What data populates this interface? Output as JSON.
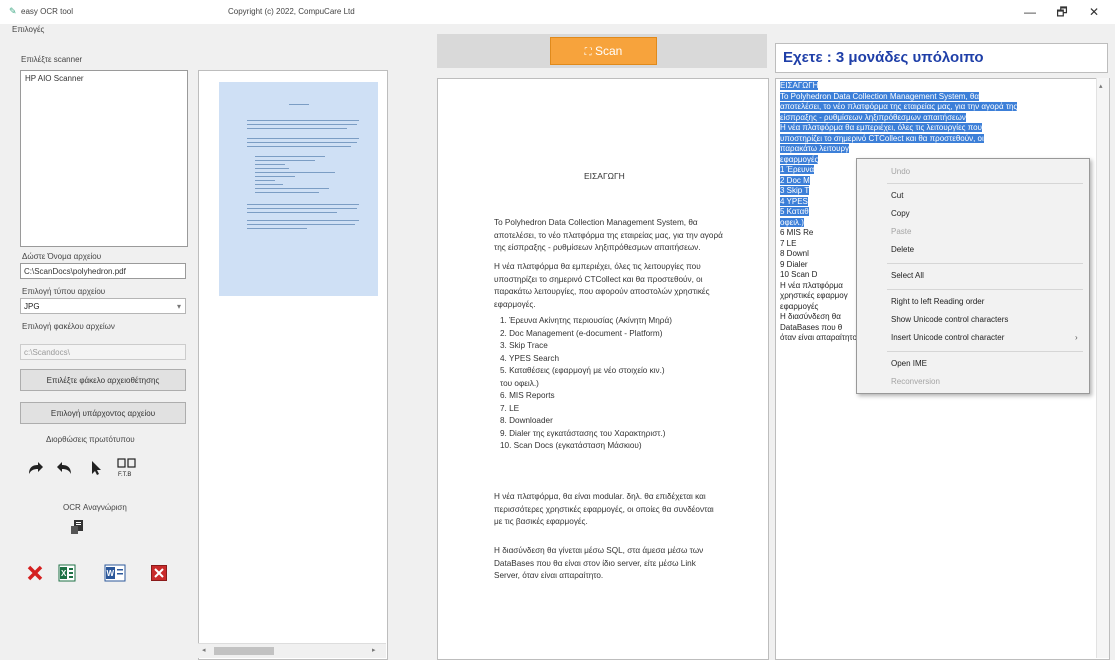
{
  "window": {
    "title": "easy OCR tool",
    "copyright": "Copyright (c) 2022, CompuCare Ltd",
    "minimize": "—",
    "maximize": "🗗",
    "close": "✕"
  },
  "menu": {
    "options": "Επιλογές"
  },
  "left": {
    "scanner_label": "Επιλέξτε scanner",
    "scanners": [
      "HP AIO Scanner"
    ],
    "filename_label": "Δώστε Όνομα αρχείου",
    "filename_value": "C:\\ScanDocs\\polyhedron.pdf",
    "filetype_label": "Επιλογή τύπου αρχείου",
    "filetype_value": "JPG",
    "folder_label": "Επιλογή φακέλου αρχείων",
    "folder_value": "c:\\Scandocs\\",
    "select_folder_button": "Επιλέξτε φάκελο αρχειοθέτησης",
    "select_existing_button": "Επιλογή υπάρχοντος αρχείου",
    "original_edit_label": "Διορθώσεις πρωτότυπου",
    "ocr_label": "OCR Αναγνώριση",
    "page_icon_text": "F.T.B"
  },
  "scan": {
    "button_label": "Scan"
  },
  "document": {
    "heading": "ΕΙΣΑΓΩΓΗ",
    "p1": "Το Polyhedron Data Collection Management System, θα αποτελέσει, το νέο πλατφόρμα της εταιρείας μας, για την αγορά της είσπραξης - ρυθμίσεων  ληξιπρόθεσμων απαιτήσεων.",
    "p2": "Η νέα πλατφόρμα θα εμπεριέχει, όλες τις λειτουργίες που υποστηρίζει το σημερινό CTCollect και θα προστεθούν, οι παρακάτω λειτουργίες, που αφορούν αποστολών χρηστικές εφαρμογές.",
    "list": [
      "1. Έρευνα Ακίνητης περιουσίας (Ακίνητη Μηρά)",
      "2. Doc Management (e-document - Platform)",
      "3. Skip Trace",
      "4. YPES Search",
      "5. Καταθέσεις (εφαρμογή με νέο στοιχείο κιν.)",
      "   του οφειλ.)",
      "6. MIS Reports",
      "7. LE",
      "8. Downloader",
      "9. Dialer της εγκατάστασης του Χαρακτηριστ.)",
      "10.    Scan Docs (εγκατάσταση Μάσκιου)"
    ],
    "p3": "Η νέα πλατφόρμα, θα είναι modular. δηλ. θα επιδέχεται και περισσότερες χρηστικές εφαρμογές, οι οποίες θα συνδέονται με τις βασικές εφαρμογές.",
    "p4": "Η διασύνδεση θα γίνεται μέσω SQL, στα άμεσα μέσω των DataBases που θα είναι στον ίδιο server, είτε μέσω Link Server, όταν είναι απαραίτητο."
  },
  "right": {
    "balance": "Εχετε : 3 μονάδες υπόλοιπο",
    "ocr_lines": [
      {
        "t": "ΕΙΣΑΓΩΓΗ",
        "h": true
      },
      {
        "t": "Το Polyhedron Data Collection Management System, θα",
        "h": true
      },
      {
        "t": "αποτελέσει, το νέο πλατφόρμα της εταιρείας μας, για την αγορά της",
        "h": true
      },
      {
        "t": "είσπραξης - ρυθμίσεων ληξιπρόθεσμων απαιτήσεων",
        "h": true
      },
      {
        "t": "Η νέα πλατφόρμα θα εμπεριέχει, όλες τις λειτουργίες που",
        "h": true
      },
      {
        "t": "υποστηρίζει το σημερινό CTCollect και θα προστεθούν, οι",
        "h": true
      },
      {
        "t": "παρακάτω λειτουργ",
        "h": true
      },
      {
        "t": "εφαρμογές",
        "h": true
      },
      {
        "t": "1          Έρευνα",
        "h": true
      },
      {
        "t": "2          Doc M",
        "h": true
      },
      {
        "t": "3          Skip T",
        "h": true
      },
      {
        "t": "4          YPES",
        "h": true
      },
      {
        "t": "5          Καταθ",
        "h": true
      },
      {
        "t": "οφειλ.)",
        "h": true
      },
      {
        "t": "6          MIS Re",
        "h": false
      },
      {
        "t": "7          LE",
        "h": false
      },
      {
        "t": "8          Downl",
        "h": false
      },
      {
        "t": "9          Dialer",
        "h": false
      },
      {
        "t": "10        Scan D",
        "h": false
      },
      {
        "t": "Η νέα πλατφόρμα",
        "h": false
      },
      {
        "t": "χρηστικές εφαρμογ",
        "h": false
      },
      {
        "t": "εφαρμογές",
        "h": false
      },
      {
        "t": "Η διασύνδεση θα",
        "h": false
      },
      {
        "t": "DataBases που θ",
        "h": false
      },
      {
        "t": "όταν είναι απαραίτητο.",
        "h": false
      }
    ]
  },
  "context_menu": {
    "undo": "Undo",
    "cut": "Cut",
    "copy": "Copy",
    "paste": "Paste",
    "delete": "Delete",
    "select_all": "Select All",
    "rtl": "Right to left Reading order",
    "show_unicode": "Show Unicode control characters",
    "insert_unicode": "Insert Unicode control character",
    "open_ime": "Open IME",
    "reconversion": "Reconversion"
  }
}
